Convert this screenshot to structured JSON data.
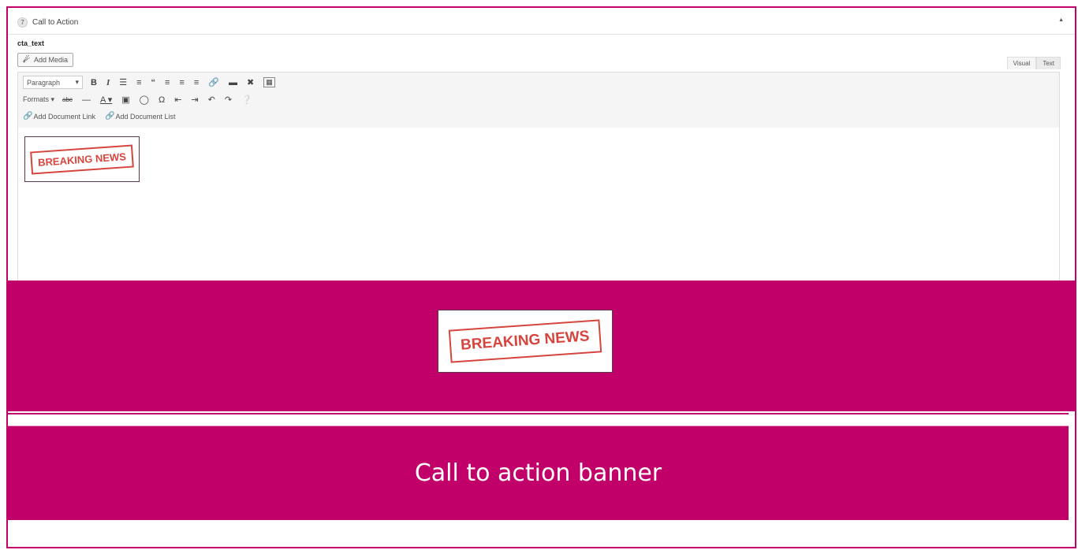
{
  "panel": {
    "number": "7",
    "title": "Call to Action",
    "collapse_icon": "triangle-up-icon"
  },
  "field": {
    "label": "cta_text"
  },
  "add_media": {
    "label": "Add Media"
  },
  "editor_tabs": [
    {
      "label": "Visual",
      "active": true
    },
    {
      "label": "Text",
      "active": false
    }
  ],
  "toolbar": {
    "format_select": "Paragraph",
    "formats_menu": "Formats ▾",
    "links": [
      "Add Document Link",
      "Add Document List"
    ]
  },
  "content": {
    "stamp_text": "BREAKING NEWS"
  },
  "preview": {
    "stamp_text": "BREAKING NEWS"
  },
  "banner": {
    "text": "Call to action banner"
  },
  "colors": {
    "accent": "#c2006a",
    "stamp": "#d6453d"
  }
}
